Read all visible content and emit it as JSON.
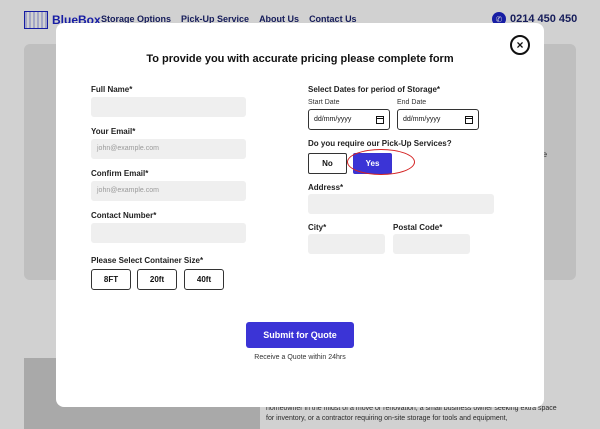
{
  "background": {
    "brand": "BlueBox",
    "nav": [
      "Storage Options",
      "Pick-Up Service",
      "About Us",
      "Contact Us"
    ],
    "phone": "0214 450 450",
    "fragment_right": "re",
    "lower_text": "homeowner in the midst of a move or renovation, a small business owner seeking extra space for inventory, or a contractor requiring on-site storage for tools and equipment,"
  },
  "modal": {
    "title": "To provide you with accurate pricing please complete form",
    "close_icon": "×",
    "full_name": {
      "label": "Full Name*",
      "value": ""
    },
    "email": {
      "label": "Your Email*",
      "placeholder": "john@example.com"
    },
    "confirm_email": {
      "label": "Confirm Email*",
      "placeholder": "john@example.com"
    },
    "contact_number": {
      "label": "Contact Number*",
      "value": ""
    },
    "container_size": {
      "label": "Please Select Container Size*",
      "options": [
        "8FT",
        "20ft",
        "40ft"
      ]
    },
    "dates": {
      "label": "Select Dates for period of Storage*",
      "start_label": "Start Date",
      "end_label": "End Date",
      "start_value": "dd/mm/yyyy",
      "end_value": "dd/mm/yyyy"
    },
    "pickup": {
      "label": "Do you require our Pick-Up Services?",
      "no": "No",
      "yes": "Yes",
      "selected": "Yes"
    },
    "address": {
      "label": "Address*",
      "value": ""
    },
    "city": {
      "label": "City*",
      "value": ""
    },
    "postal_code": {
      "label": "Postal Code*",
      "value": ""
    },
    "submit_label": "Submit for Quote",
    "submit_note": "Receive a Quote within 24hrs"
  },
  "colors": {
    "accent": "#3b34d6",
    "brand": "#1d24c9",
    "highlight_ring": "#d42323"
  }
}
